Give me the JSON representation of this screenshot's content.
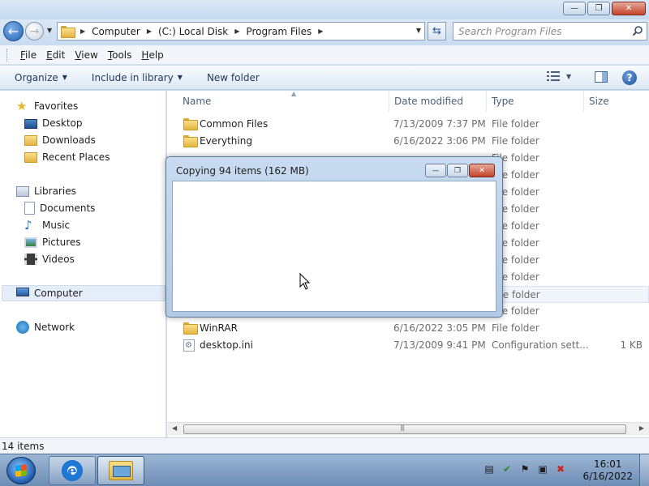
{
  "window": {
    "minimize_glyph": "—",
    "maximize_glyph": "❐",
    "close_glyph": "✕"
  },
  "navigation": {
    "back_glyph": "←",
    "forward_glyph": "→",
    "breadcrumbs": [
      "Computer",
      "(C:) Local Disk",
      "Program Files"
    ],
    "refresh_glyph": "⇆",
    "search_placeholder": "Search Program Files"
  },
  "menu": {
    "items": [
      {
        "key": "F",
        "rest": "ile"
      },
      {
        "key": "E",
        "rest": "dit"
      },
      {
        "key": "V",
        "rest": "iew"
      },
      {
        "key": "T",
        "rest": "ools"
      },
      {
        "key": "H",
        "rest": "elp"
      }
    ]
  },
  "commandbar": {
    "organize": "Organize",
    "include_in_library": "Include in library",
    "new_folder": "New folder",
    "help_glyph": "?"
  },
  "sidebar": {
    "favorites": "Favorites",
    "desktop": "Desktop",
    "downloads": "Downloads",
    "recent_places": "Recent Places",
    "libraries": "Libraries",
    "documents": "Documents",
    "music": "Music",
    "pictures": "Pictures",
    "videos": "Videos",
    "computer": "Computer",
    "network": "Network"
  },
  "columns": {
    "name": "Name",
    "date_modified": "Date modified",
    "type": "Type",
    "size": "Size"
  },
  "files": [
    {
      "name": "Common Files",
      "date": "7/13/2009 7:37 PM",
      "type": "File folder",
      "size": ""
    },
    {
      "name": "Everything",
      "date": "6/16/2022 3:06 PM",
      "type": "File folder",
      "size": ""
    },
    {
      "name": "WinRAR",
      "date": "6/16/2022 3:05 PM",
      "type": "File folder",
      "size": ""
    },
    {
      "name": "desktop.ini",
      "date": "7/13/2009 9:41 PM",
      "type": "Configuration sett...",
      "size": "1 KB"
    }
  ],
  "hidden_rows_type": "File folder",
  "status": {
    "item_count": "14 items"
  },
  "dialog": {
    "title": "Copying 94 items (162 MB)"
  },
  "taskbar": {
    "time": "16:01",
    "date": "6/16/2022"
  }
}
